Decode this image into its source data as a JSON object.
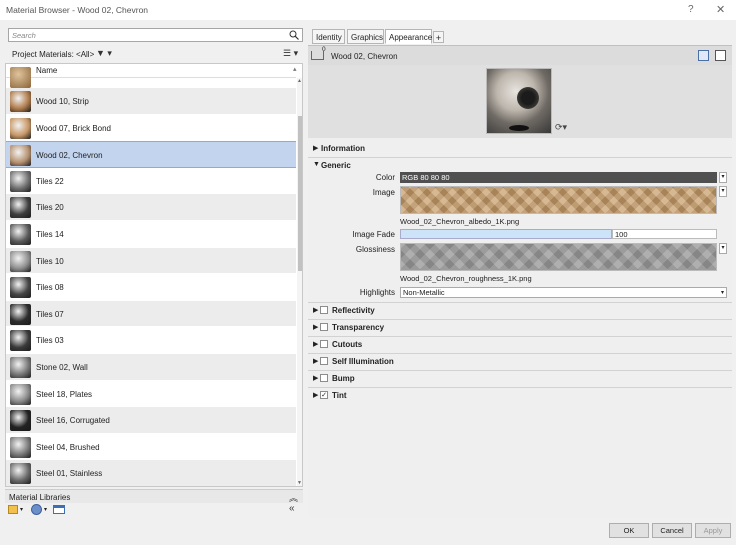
{
  "window": {
    "title": "Material Browser - Wood 02, Chevron",
    "help": "?",
    "close": "✕"
  },
  "left": {
    "search_placeholder": "Search",
    "project_label": "Project Materials: <All>",
    "filter_icon": "▼ ▾",
    "view_icon": "☰ ▾",
    "column_header": "Name",
    "materials": [
      {
        "name": "Wood 10, Strip",
        "swatch": "#b07c4c"
      },
      {
        "name": "Wood 07, Brick Bond",
        "swatch": "#c79766"
      },
      {
        "name": "Wood 02, Chevron",
        "swatch": "#b69270",
        "selected": true
      },
      {
        "name": "Tiles 22",
        "swatch": "#6f6f6f"
      },
      {
        "name": "Tiles 20",
        "swatch": "#3e3e3e"
      },
      {
        "name": "Tiles 14",
        "swatch": "#5a5a5a"
      },
      {
        "name": "Tiles 10",
        "swatch": "#8e8e8e"
      },
      {
        "name": "Tiles 08",
        "swatch": "#454545"
      },
      {
        "name": "Tiles 07",
        "swatch": "#2d2d2d"
      },
      {
        "name": "Tiles 03",
        "swatch": "#3a3a3a"
      },
      {
        "name": "Stone 02, Wall",
        "swatch": "#777777"
      },
      {
        "name": "Steel 18, Plates",
        "swatch": "#8a8a8a"
      },
      {
        "name": "Steel 16, Corrugated",
        "swatch": "#222222"
      },
      {
        "name": "Steel 04, Brushed",
        "swatch": "#7a7a7a"
      },
      {
        "name": "Steel 01, Stainless",
        "swatch": "#6a6a6a"
      }
    ],
    "library_label": "Material Libraries",
    "collapse_up": "︽",
    "collapse_left": "«"
  },
  "right": {
    "tabs": [
      "Identity",
      "Graphics",
      "Appearance"
    ],
    "add_tab": "+",
    "asset_count": "0",
    "asset_name": "Wood 02, Chevron",
    "sections": {
      "information": "Information",
      "generic": "Generic",
      "reflectivity": "Reflectivity",
      "transparency": "Transparency",
      "cutouts": "Cutouts",
      "self_illumination": "Self Illumination",
      "bump": "Bump",
      "tint": "Tint"
    },
    "props": {
      "color_label": "Color",
      "color_value": "RGB 80 80 80",
      "image_label": "Image",
      "image_file": "Wood_02_Chevron_albedo_1K.png",
      "fade_label": "Image Fade",
      "fade_value": "100",
      "fade_level": 1.0,
      "gloss_label": "Glossiness",
      "gloss_file": "Wood_02_Chevron_roughness_1K.png",
      "highlights_label": "Highlights",
      "highlights_value": "Non-Metallic"
    },
    "tint_checked": "✓"
  },
  "footer": {
    "ok": "OK",
    "cancel": "Cancel",
    "apply": "Apply"
  }
}
